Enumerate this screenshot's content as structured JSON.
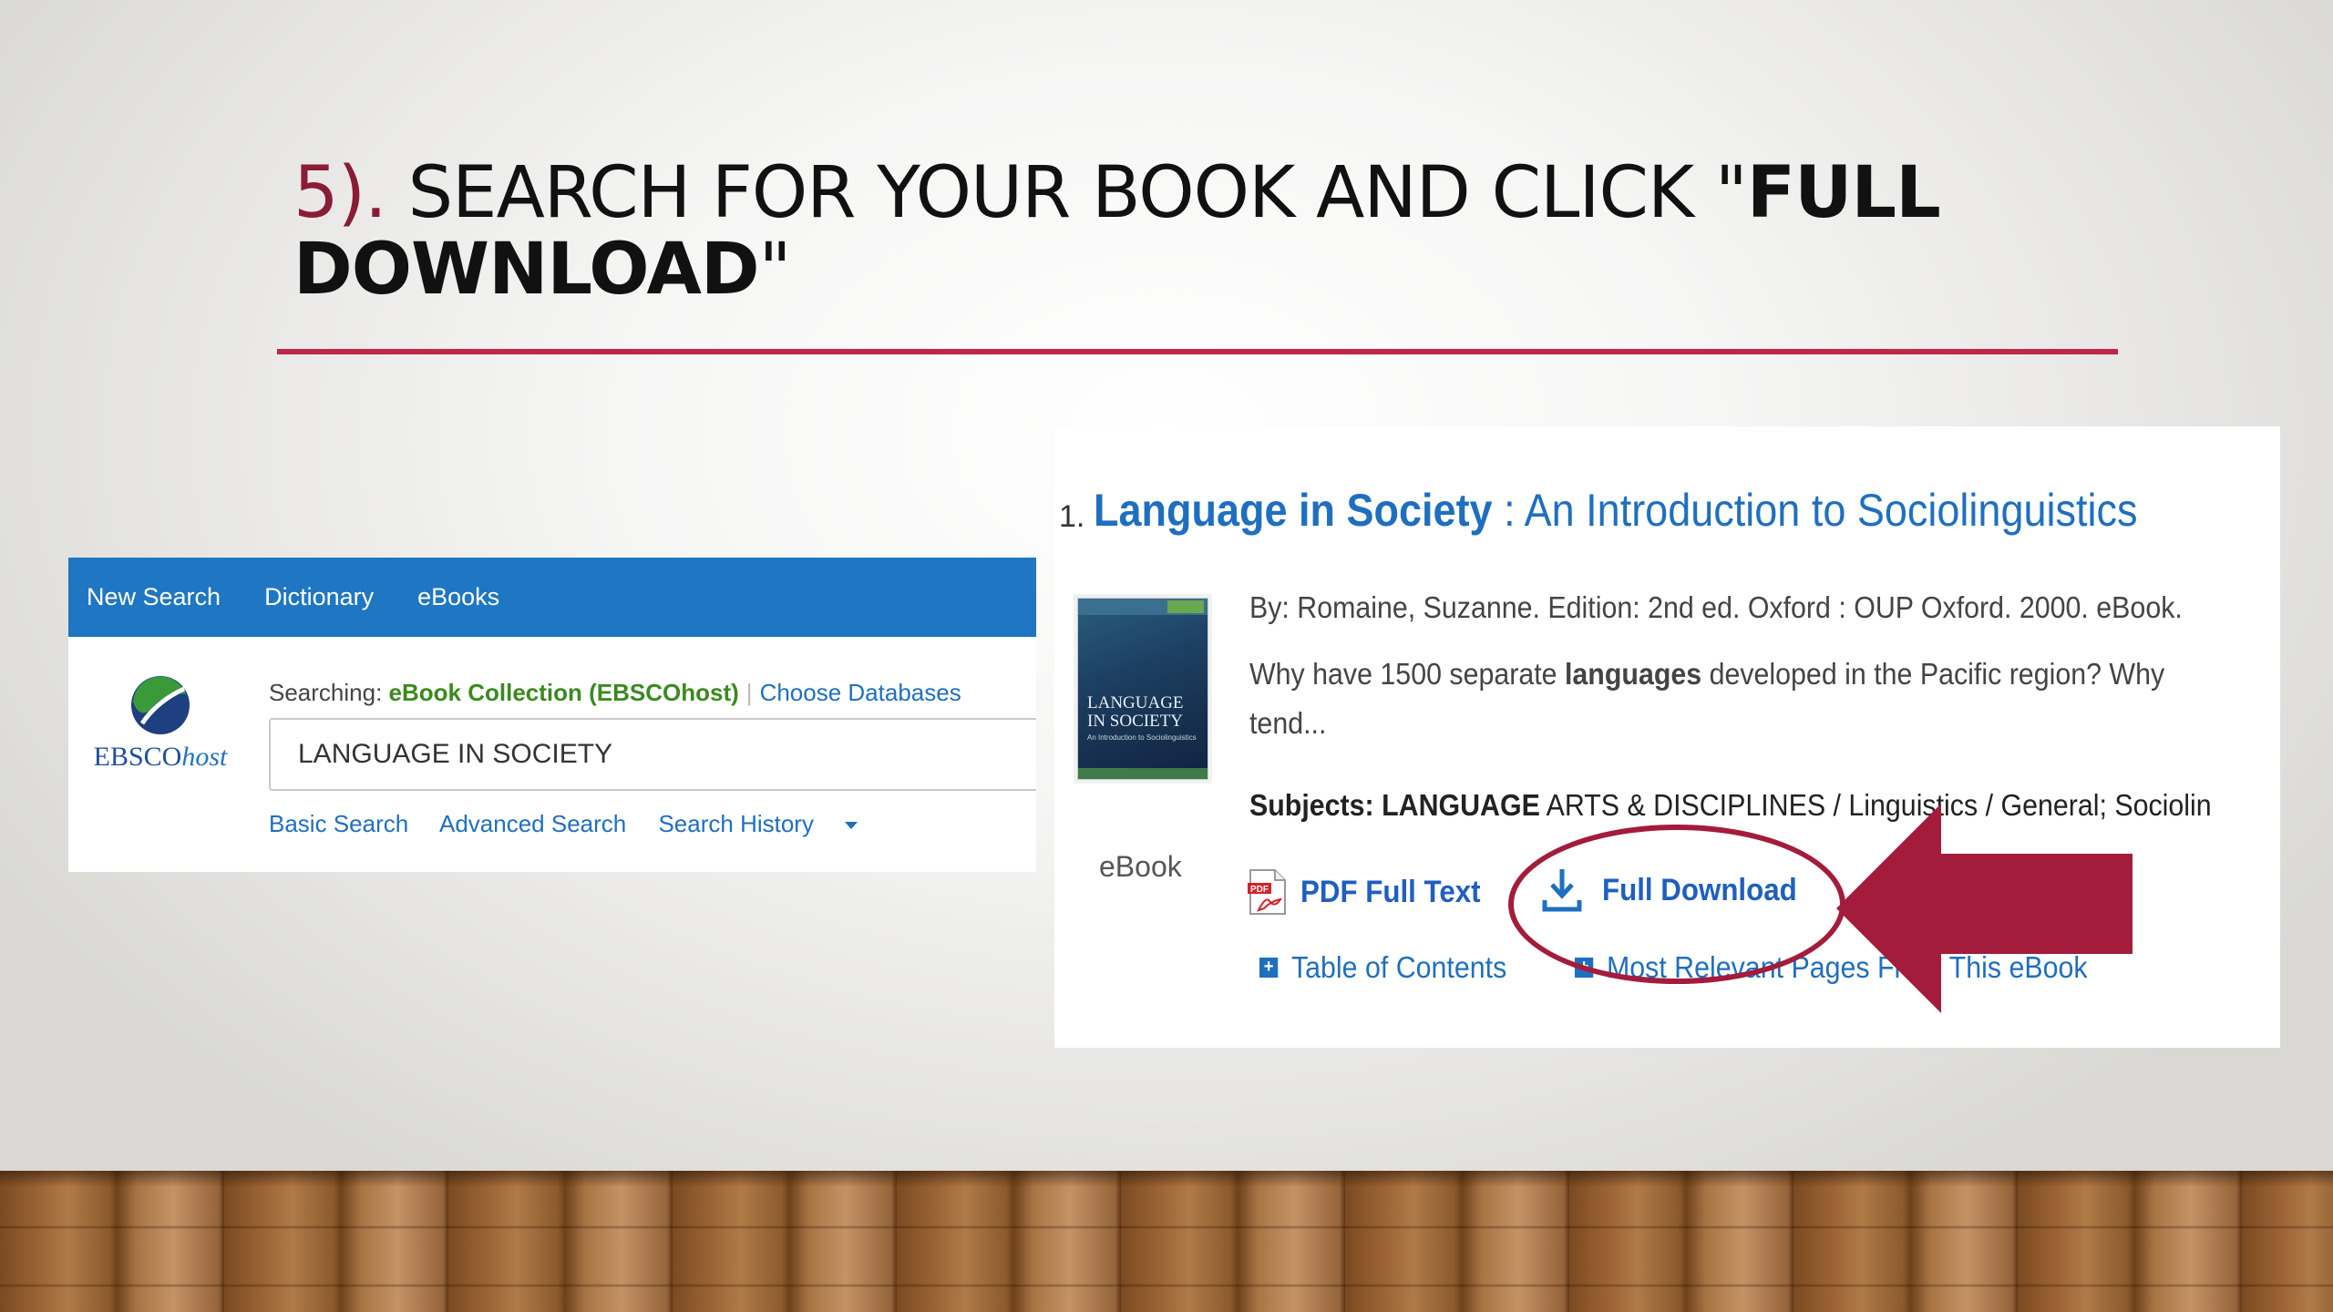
{
  "slide": {
    "step_number": "5).",
    "title_light": "SEARCH FOR YOUR BOOK AND CLICK \"",
    "title_bold": "FULL DOWNLOAD",
    "title_end": "\"",
    "accent_color": "#c0264a"
  },
  "ebsco": {
    "nav": [
      "New Search",
      "Dictionary",
      "eBooks"
    ],
    "logo_main": "EBSCO",
    "logo_host": "host",
    "searching_label": "Searching:",
    "database": "eBook Collection (EBSCOhost)",
    "choose_databases": "Choose Databases",
    "search_value": "LANGUAGE IN SOCIETY",
    "links": [
      "Basic Search",
      "Advanced Search",
      "Search History"
    ],
    "nav_color": "#1f76c2"
  },
  "result": {
    "number": "1.",
    "title_main": "Language in Society",
    "title_sub": " : An Introduction to Sociolinguistics",
    "cover_title": "LANGUAGE IN SOCIETY",
    "cover_subtitle": "An Introduction to Sociolinguistics",
    "type": "eBook",
    "byline": "By: Romaine, Suzanne. Edition: 2nd ed. Oxford : OUP Oxford. 2000. eBook.",
    "abstract_before": "Why have 1500 separate ",
    "abstract_bold": "languages",
    "abstract_after": " developed in the Pacific region? Why",
    "abstract_line2": "tend...",
    "subjects_label": "Subjects:",
    "subjects_bold": "LANGUAGE",
    "subjects_rest": " ARTS & DISCIPLINES / Linguistics / General; Sociolin",
    "pdf_label": "PDF Full Text",
    "download_label": "Full Download",
    "toc_label": "Table of Contents",
    "relevant_label": "Most Relevant Pages From This eBook",
    "link_color": "#1f6fbf"
  },
  "annotation": {
    "color": "#a31c3b",
    "arrow_icon": "left-arrow-icon"
  }
}
